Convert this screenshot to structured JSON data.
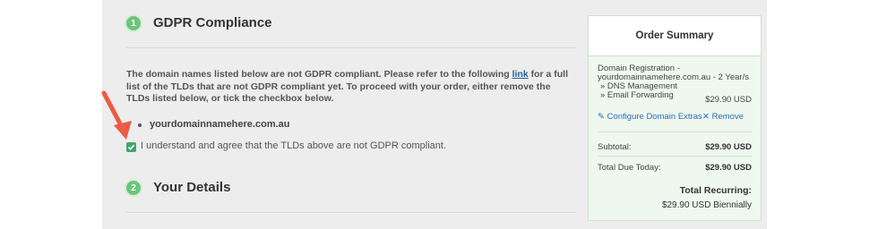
{
  "steps": [
    {
      "number": "1",
      "title": "GDPR Compliance"
    },
    {
      "number": "2",
      "title": "Your Details"
    }
  ],
  "gdpr": {
    "text_before_link": "The domain names listed below are not GDPR compliant. Please refer to the following ",
    "link_label": "link",
    "text_after_link": " for a full list of the TLDs that are not GDPR compliant yet. To proceed with your order, either remove the TLDs listed below, or tick the checkbox below.",
    "domains": [
      "yourdomainnamehere.com.au"
    ],
    "agree_label": "I understand and agree that the TLDs above are not GDPR compliant.",
    "agree_checked": true
  },
  "summary": {
    "title": "Order Summary",
    "item_line1": "Domain Registration -",
    "item_line2": "yourdomainnamehere.com.au - 2 Year/s",
    "addon1": "» DNS Management",
    "addon2": "» Email Forwarding",
    "item_price": "$29.90 USD",
    "configure_label": "Configure Domain Extras",
    "remove_label": "Remove",
    "subtotal_label": "Subtotal:",
    "subtotal_value": "$29.90 USD",
    "total_due_label": "Total Due Today:",
    "total_due_value": "$29.90 USD",
    "recurring_label": "Total Recurring:",
    "recurring_value": "$29.90 USD Biennially"
  },
  "colors": {
    "step_badge": "#6cc47a",
    "checkbox": "#3ea86a",
    "arrow": "#ee5a45",
    "link": "#1f5f9c"
  }
}
